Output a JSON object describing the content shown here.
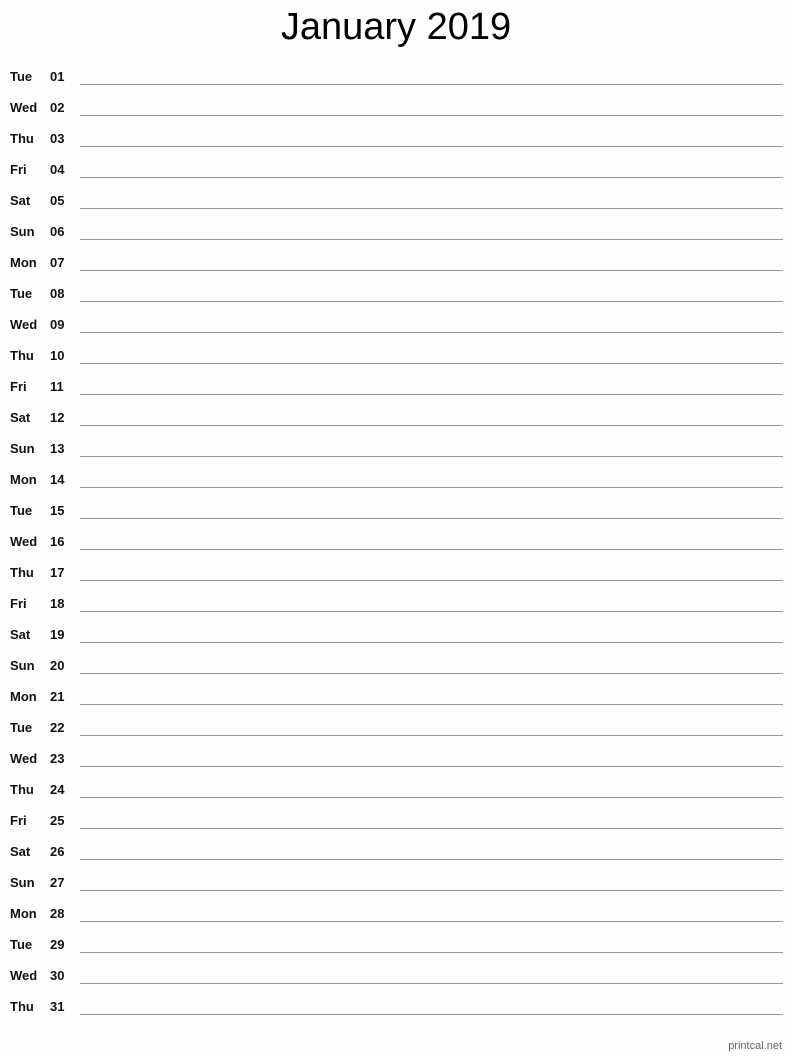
{
  "title": "January 2019",
  "days": [
    {
      "dow": "Tue",
      "num": "01"
    },
    {
      "dow": "Wed",
      "num": "02"
    },
    {
      "dow": "Thu",
      "num": "03"
    },
    {
      "dow": "Fri",
      "num": "04"
    },
    {
      "dow": "Sat",
      "num": "05"
    },
    {
      "dow": "Sun",
      "num": "06"
    },
    {
      "dow": "Mon",
      "num": "07"
    },
    {
      "dow": "Tue",
      "num": "08"
    },
    {
      "dow": "Wed",
      "num": "09"
    },
    {
      "dow": "Thu",
      "num": "10"
    },
    {
      "dow": "Fri",
      "num": "11"
    },
    {
      "dow": "Sat",
      "num": "12"
    },
    {
      "dow": "Sun",
      "num": "13"
    },
    {
      "dow": "Mon",
      "num": "14"
    },
    {
      "dow": "Tue",
      "num": "15"
    },
    {
      "dow": "Wed",
      "num": "16"
    },
    {
      "dow": "Thu",
      "num": "17"
    },
    {
      "dow": "Fri",
      "num": "18"
    },
    {
      "dow": "Sat",
      "num": "19"
    },
    {
      "dow": "Sun",
      "num": "20"
    },
    {
      "dow": "Mon",
      "num": "21"
    },
    {
      "dow": "Tue",
      "num": "22"
    },
    {
      "dow": "Wed",
      "num": "23"
    },
    {
      "dow": "Thu",
      "num": "24"
    },
    {
      "dow": "Fri",
      "num": "25"
    },
    {
      "dow": "Sat",
      "num": "26"
    },
    {
      "dow": "Sun",
      "num": "27"
    },
    {
      "dow": "Mon",
      "num": "28"
    },
    {
      "dow": "Tue",
      "num": "29"
    },
    {
      "dow": "Wed",
      "num": "30"
    },
    {
      "dow": "Thu",
      "num": "31"
    }
  ],
  "footer": "printcal.net"
}
